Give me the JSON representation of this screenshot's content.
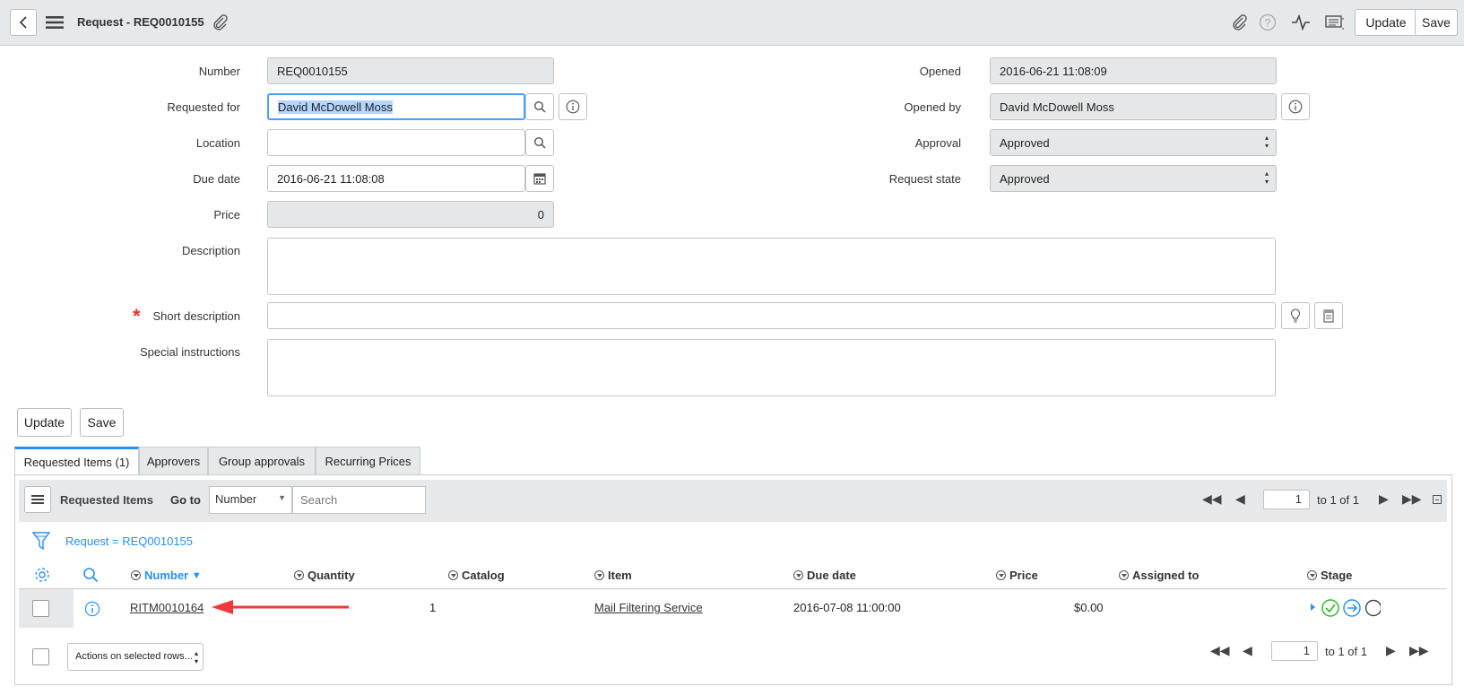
{
  "header": {
    "title": "Request - REQ0010155",
    "update_label": "Update",
    "save_label": "Save"
  },
  "form": {
    "number": {
      "label": "Number",
      "value": "REQ0010155"
    },
    "requested_for": {
      "label": "Requested for",
      "value": "David McDowell Moss"
    },
    "location": {
      "label": "Location",
      "value": ""
    },
    "due_date": {
      "label": "Due date",
      "value": "2016-06-21 11:08:08"
    },
    "price": {
      "label": "Price",
      "value": "0"
    },
    "description": {
      "label": "Description",
      "value": ""
    },
    "short_description": {
      "label": "Short description",
      "value": ""
    },
    "special_instructions": {
      "label": "Special instructions",
      "value": ""
    },
    "opened": {
      "label": "Opened",
      "value": "2016-06-21 11:08:09"
    },
    "opened_by": {
      "label": "Opened by",
      "value": "David McDowell Moss"
    },
    "approval": {
      "label": "Approval",
      "value": "Approved"
    },
    "request_state": {
      "label": "Request state",
      "value": "Approved"
    },
    "required_marker": "*"
  },
  "actions": {
    "update_label": "Update",
    "save_label": "Save"
  },
  "tabs": [
    {
      "label": "Requested Items (1)",
      "active": true
    },
    {
      "label": "Approvers"
    },
    {
      "label": "Group approvals"
    },
    {
      "label": "Recurring Prices"
    }
  ],
  "list": {
    "title": "Requested Items",
    "goto_label": "Go to",
    "goto_field": "Number",
    "search_placeholder": "Search",
    "filter_text": "Request = REQ0010155",
    "page_value": "1",
    "page_range": "to 1 of 1",
    "columns": [
      "Number",
      "Quantity",
      "Catalog",
      "Item",
      "Due date",
      "Price",
      "Assigned to",
      "Stage"
    ],
    "sort_indicator": "▼",
    "rows": [
      {
        "number": "RITM0010164",
        "quantity": "1",
        "catalog": "",
        "item": "Mail Filtering Service",
        "due_date": "2016-07-08 11:00:00",
        "price": "$0.00",
        "assigned_to": ""
      }
    ],
    "actions_select": "Actions on selected rows...",
    "bottom_page_value": "1",
    "bottom_page_range": "to 1 of 1"
  },
  "colors": {
    "accent": "#278efc",
    "arrow": "#ee3a3a",
    "stage_done": "#2db82d"
  }
}
